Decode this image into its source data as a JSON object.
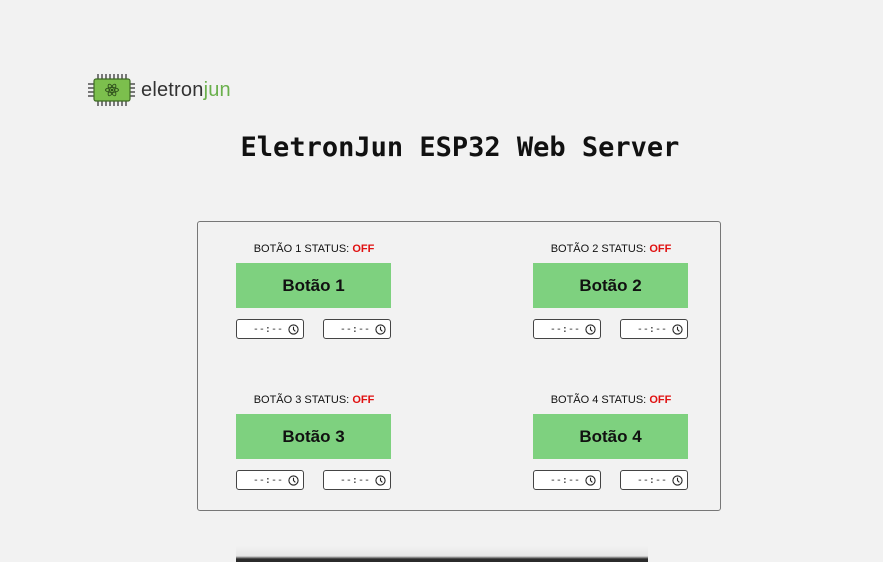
{
  "logo": {
    "text_part1": "eletron",
    "text_part2": "jun"
  },
  "title": "EletronJun ESP32 Web Server",
  "controls": [
    {
      "status_label": "BOTÃO 1 STATUS:",
      "status_value": "OFF",
      "button_label": "Botão 1",
      "time_on": "--:--",
      "time_off": "--:--"
    },
    {
      "status_label": "BOTÃO 2 STATUS:",
      "status_value": "OFF",
      "button_label": "Botão 2",
      "time_on": "--:--",
      "time_off": "--:--"
    },
    {
      "status_label": "BOTÃO 3 STATUS:",
      "status_value": "OFF",
      "button_label": "Botão 3",
      "time_on": "--:--",
      "time_off": "--:--"
    },
    {
      "status_label": "BOTÃO 4 STATUS:",
      "status_value": "OFF",
      "button_label": "Botão 4",
      "time_on": "--:--",
      "time_off": "--:--"
    }
  ],
  "colors": {
    "button_green": "#7ed17f",
    "status_off": "#e01010",
    "logo_green": "#6ab04c"
  },
  "icons": {
    "logo": "chip-atom-icon",
    "time": "clock-icon"
  }
}
